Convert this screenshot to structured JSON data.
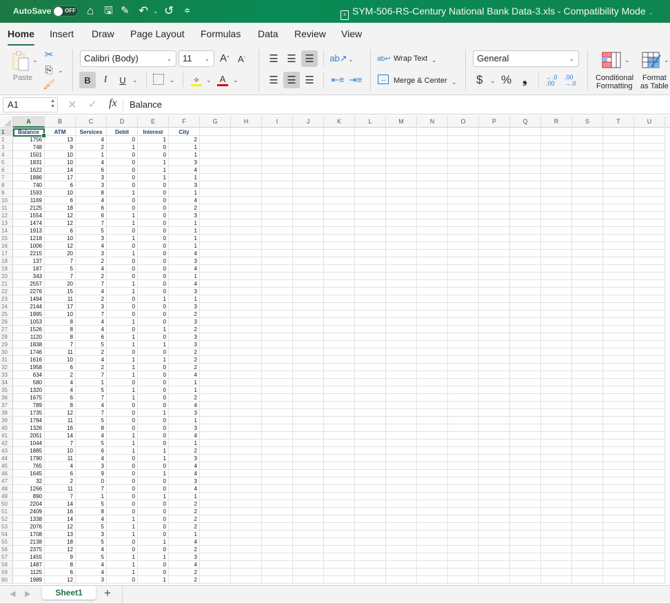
{
  "titlebar": {
    "autosave_label": "AutoSave",
    "autosave_state": "OFF",
    "document_title": "SYM-506-RS-Century National Bank Data-3.xls  -  Compatibility Mode",
    "quick_access_icons": [
      "home-icon",
      "save-icon",
      "edit-icon",
      "undo-icon",
      "redo-icon",
      "customize-icon"
    ]
  },
  "ribbon_tabs": [
    {
      "label": "Home",
      "active": true
    },
    {
      "label": "Insert"
    },
    {
      "label": "Draw"
    },
    {
      "label": "Page Layout"
    },
    {
      "label": "Formulas"
    },
    {
      "label": "Data"
    },
    {
      "label": "Review"
    },
    {
      "label": "View"
    }
  ],
  "ribbon": {
    "paste_label": "Paste",
    "font_name": "Calibri (Body)",
    "font_size": "11",
    "bold_label": "B",
    "italic_label": "I",
    "underline_label": "U",
    "wrap_text_label": "Wrap Text",
    "merge_center_label": "Merge & Center",
    "number_format": "General",
    "currency_symbol": "$",
    "percent_symbol": "%",
    "comma_symbol": "❟",
    "conditional_formatting_label_1": "Conditional",
    "conditional_formatting_label_2": "Formatting",
    "format_table_label_1": "Format",
    "format_table_label_2": "as Table",
    "colors": {
      "highlight": "#f5f500",
      "font_color": "#e00000",
      "accent": "#1e7145"
    }
  },
  "formula_bar": {
    "name_box": "A1",
    "fx_label": "fx",
    "value": "Balance"
  },
  "columns": [
    "A",
    "B",
    "C",
    "D",
    "E",
    "F",
    "G",
    "H",
    "I",
    "J",
    "K",
    "L",
    "M",
    "N",
    "O",
    "P",
    "Q",
    "R",
    "S",
    "T",
    "U"
  ],
  "selected_cell": "A1",
  "headers": [
    "Balance",
    "ATM",
    "Services",
    "Debit",
    "Interest",
    "City"
  ],
  "rows": [
    [
      1756,
      13,
      4,
      0,
      1,
      2
    ],
    [
      748,
      9,
      2,
      1,
      0,
      1
    ],
    [
      1501,
      10,
      1,
      0,
      0,
      1
    ],
    [
      1831,
      10,
      4,
      0,
      1,
      3
    ],
    [
      1622,
      14,
      6,
      0,
      1,
      4
    ],
    [
      1886,
      17,
      3,
      0,
      1,
      1
    ],
    [
      740,
      6,
      3,
      0,
      0,
      3
    ],
    [
      1593,
      10,
      8,
      1,
      0,
      1
    ],
    [
      1169,
      6,
      4,
      0,
      0,
      4
    ],
    [
      2125,
      18,
      6,
      0,
      0,
      2
    ],
    [
      1554,
      12,
      6,
      1,
      0,
      3
    ],
    [
      1474,
      12,
      7,
      1,
      0,
      1
    ],
    [
      1913,
      6,
      5,
      0,
      0,
      1
    ],
    [
      1218,
      10,
      3,
      1,
      0,
      1
    ],
    [
      1006,
      12,
      4,
      0,
      0,
      1
    ],
    [
      2215,
      20,
      3,
      1,
      0,
      4
    ],
    [
      137,
      7,
      2,
      0,
      0,
      3
    ],
    [
      167,
      5,
      4,
      0,
      0,
      4
    ],
    [
      343,
      7,
      2,
      0,
      0,
      1
    ],
    [
      2557,
      20,
      7,
      1,
      0,
      4
    ],
    [
      2276,
      15,
      4,
      1,
      0,
      3
    ],
    [
      1494,
      11,
      2,
      0,
      1,
      1
    ],
    [
      2144,
      17,
      3,
      0,
      0,
      3
    ],
    [
      1995,
      10,
      7,
      0,
      0,
      2
    ],
    [
      1053,
      8,
      4,
      1,
      0,
      3
    ],
    [
      1526,
      8,
      4,
      0,
      1,
      2
    ],
    [
      1120,
      8,
      6,
      1,
      0,
      3
    ],
    [
      1838,
      7,
      5,
      1,
      1,
      3
    ],
    [
      1746,
      11,
      2,
      0,
      0,
      2
    ],
    [
      1616,
      10,
      4,
      1,
      1,
      2
    ],
    [
      1958,
      6,
      2,
      1,
      0,
      2
    ],
    [
      634,
      2,
      7,
      1,
      0,
      4
    ],
    [
      580,
      4,
      1,
      0,
      0,
      1
    ],
    [
      1320,
      4,
      5,
      1,
      0,
      1
    ],
    [
      1675,
      6,
      7,
      1,
      0,
      2
    ],
    [
      789,
      8,
      4,
      0,
      0,
      4
    ],
    [
      1735,
      12,
      7,
      0,
      1,
      3
    ],
    [
      1784,
      11,
      5,
      0,
      0,
      1
    ],
    [
      1326,
      16,
      8,
      0,
      0,
      3
    ],
    [
      2051,
      14,
      4,
      1,
      0,
      4
    ],
    [
      1044,
      7,
      5,
      1,
      0,
      1
    ],
    [
      1885,
      10,
      6,
      1,
      1,
      2
    ],
    [
      1790,
      11,
      4,
      0,
      1,
      3
    ],
    [
      765,
      4,
      3,
      0,
      0,
      4
    ],
    [
      1645,
      6,
      9,
      0,
      1,
      4
    ],
    [
      32,
      2,
      0,
      0,
      0,
      3
    ],
    [
      1266,
      11,
      7,
      0,
      0,
      4
    ],
    [
      890,
      7,
      1,
      0,
      1,
      1
    ],
    [
      2204,
      14,
      5,
      0,
      0,
      2
    ],
    [
      2409,
      16,
      8,
      0,
      0,
      2
    ],
    [
      1338,
      14,
      4,
      1,
      0,
      2
    ],
    [
      2076,
      12,
      5,
      1,
      0,
      2
    ],
    [
      1708,
      13,
      3,
      1,
      0,
      1
    ],
    [
      2138,
      18,
      5,
      0,
      1,
      4
    ],
    [
      2375,
      12,
      4,
      0,
      0,
      2
    ],
    [
      1455,
      9,
      5,
      1,
      1,
      3
    ],
    [
      1487,
      8,
      4,
      1,
      0,
      4
    ],
    [
      1125,
      6,
      4,
      1,
      0,
      2
    ],
    [
      1989,
      12,
      3,
      0,
      1,
      2
    ]
  ],
  "sheet_tabs": [
    {
      "label": "Sheet1",
      "active": true
    }
  ],
  "add_sheet_label": "+"
}
